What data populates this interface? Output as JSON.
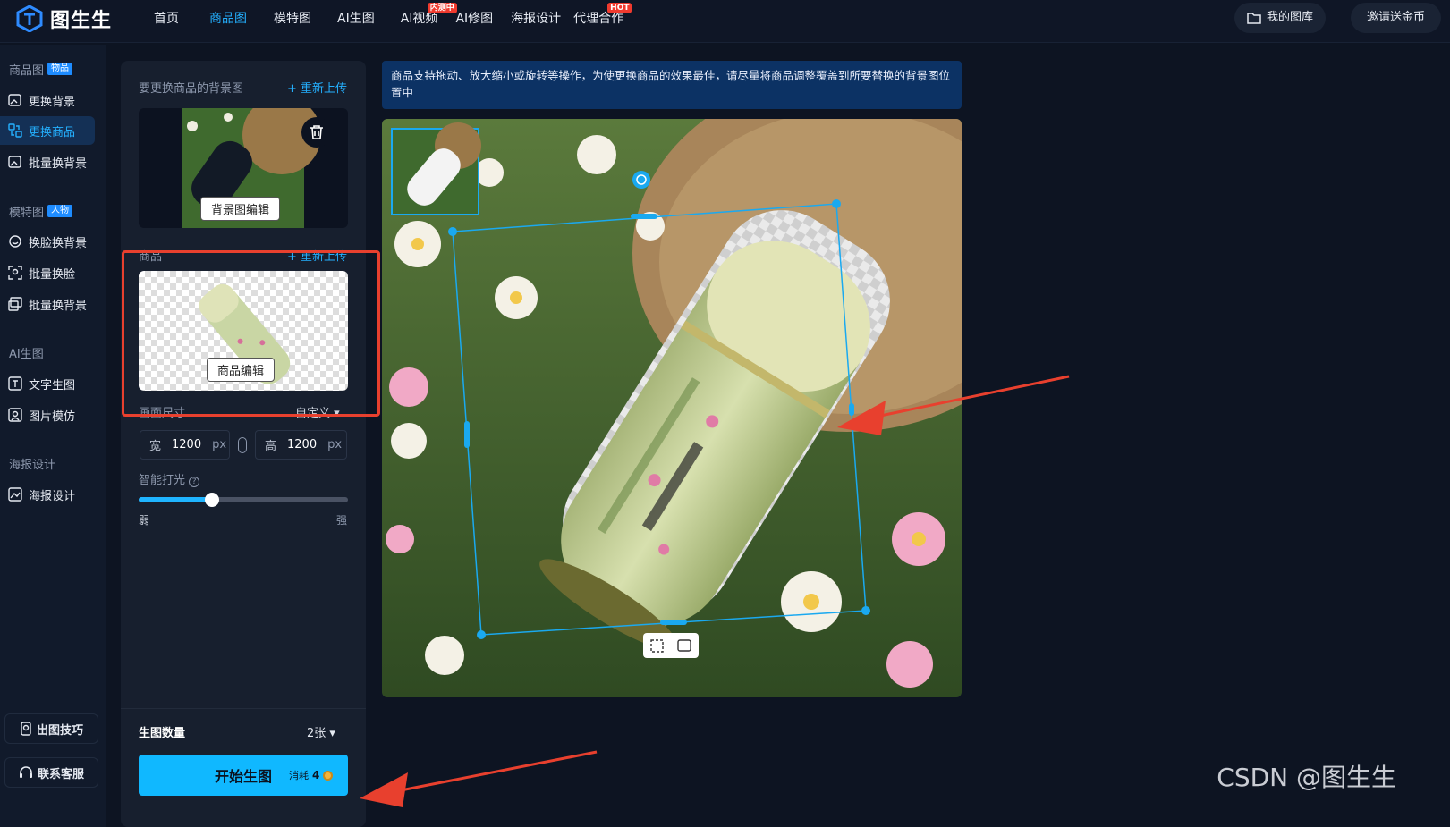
{
  "app": {
    "name": "图生生"
  },
  "nav": {
    "items": [
      {
        "label": "首页"
      },
      {
        "label": "商品图"
      },
      {
        "label": "模特图"
      },
      {
        "label": "AI生图"
      },
      {
        "label": "AI视频",
        "badge": "内测中"
      },
      {
        "label": "AI修图"
      },
      {
        "label": "海报设计"
      },
      {
        "label": "代理合作",
        "badge": "HOT"
      }
    ],
    "my_gallery": "我的图库",
    "invite": "邀请送金币"
  },
  "sidebar": {
    "group1": {
      "label": "商品图",
      "tag": "物品"
    },
    "g1_items": [
      "更换背景",
      "更换商品",
      "批量换背景"
    ],
    "group2": {
      "label": "模特图",
      "tag": "人物"
    },
    "g2_items": [
      "换脸换背景",
      "批量换脸",
      "批量换背景"
    ],
    "group3": {
      "label": "AI生图"
    },
    "g3_items": [
      "文字生图",
      "图片模仿"
    ],
    "group4": {
      "label": "海报设计"
    },
    "g4_items": [
      "海报设计"
    ],
    "tips": "出图技巧",
    "support": "联系客服"
  },
  "panel": {
    "bg_label": "要更换商品的背景图",
    "reupload": "+ 重新上传",
    "bg_edit": "背景图编辑",
    "product_label": "商品",
    "product_edit": "商品编辑",
    "canvas_size_label": "画面尺寸",
    "canvas_size_value": "自定义",
    "width_label": "宽",
    "width_value": "1200",
    "height_label": "高",
    "height_value": "1200",
    "unit": "px",
    "lighting_label": "智能打光",
    "lighting_level": 0.35,
    "weak": "弱",
    "strong": "强",
    "count_label": "生图数量",
    "count_value": "2张",
    "start": "开始生图",
    "cost_label": "消耗",
    "cost_value": "4"
  },
  "tip": "商品支持拖动、放大缩小或旋转等操作，为使更换商品的效果最佳，请尽量将商品调整覆盖到所要替换的背景图位置中",
  "watermark": "CSDN @图生生",
  "colors": {
    "accent": "#24b0ff",
    "annotation": "#e8402e",
    "handle": "#1aa9f0"
  }
}
